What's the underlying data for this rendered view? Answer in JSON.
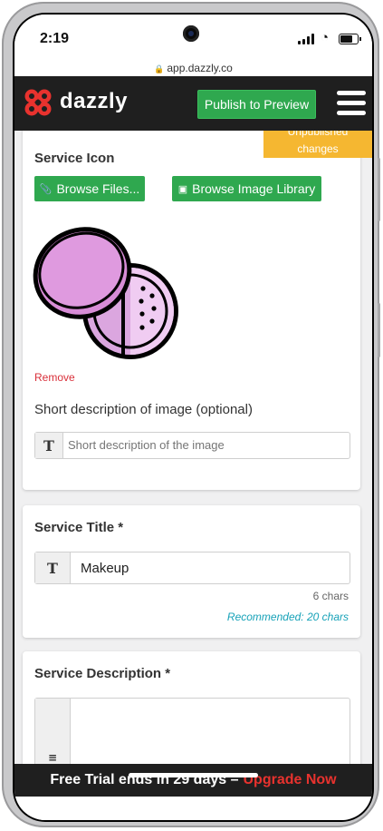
{
  "status": {
    "time": "2:19"
  },
  "browser": {
    "url": "app.dazzly.co"
  },
  "header": {
    "logo_text": "dazzly",
    "publish_label": "Publish to Preview"
  },
  "badge": {
    "unpublished_line1": "Unpublished",
    "unpublished_line2": "changes"
  },
  "icon_card": {
    "title": "Service Icon",
    "browse_files_label": "Browse Files...",
    "browse_library_label": "Browse Image Library",
    "remove_label": "Remove",
    "image_icon_name": "compact-powder-icon",
    "short_desc_label": "Short description of image (optional)",
    "short_desc_placeholder": "Short description of the image",
    "short_desc_value": ""
  },
  "title_card": {
    "title": "Service Title *",
    "value": "Makeup",
    "char_count": "6 chars",
    "recommended": "Recommended: 20 chars"
  },
  "desc_card": {
    "title": "Service Description *",
    "value": ""
  },
  "trial_bar": {
    "text": "Free Trial ends in 29 days –",
    "upgrade_label": "Upgrade Now"
  },
  "colors": {
    "accent_green": "#2fa84f",
    "header_bg": "#1f1f1f",
    "badge_orange": "#f5b731",
    "brand_red": "#e8322e",
    "hint_teal": "#17a2b8"
  }
}
